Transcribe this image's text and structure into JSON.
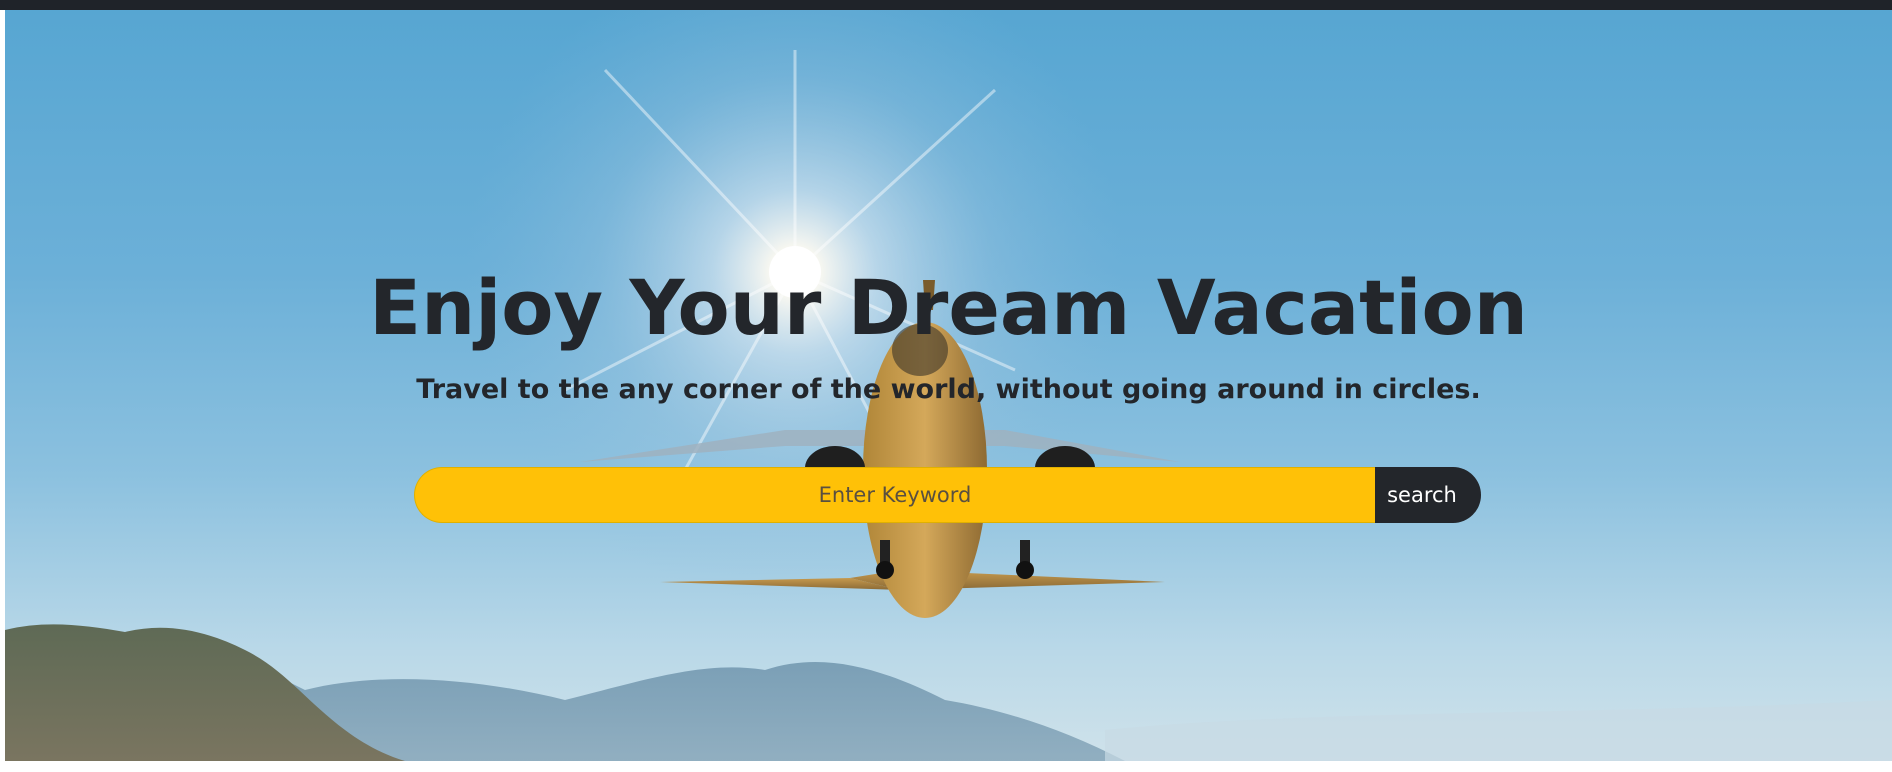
{
  "hero": {
    "title": "Enjoy Your Dream Vacation",
    "subtitle": "Travel to the any corner of the world, without going around in circles."
  },
  "search": {
    "placeholder": "Enter Keyword",
    "value": "",
    "button_label": "search"
  },
  "colors": {
    "top_bar": "#1f2329",
    "sky_top": "#57a6d2",
    "sky_bottom": "#cfe2ea",
    "heading_text": "#23262b",
    "search_input_bg": "#ffc107",
    "search_button_bg": "#23262b",
    "search_button_text": "#ffffff"
  },
  "background_image": {
    "subject": "airplane-taking-off-toward-sun-over-mountains"
  }
}
